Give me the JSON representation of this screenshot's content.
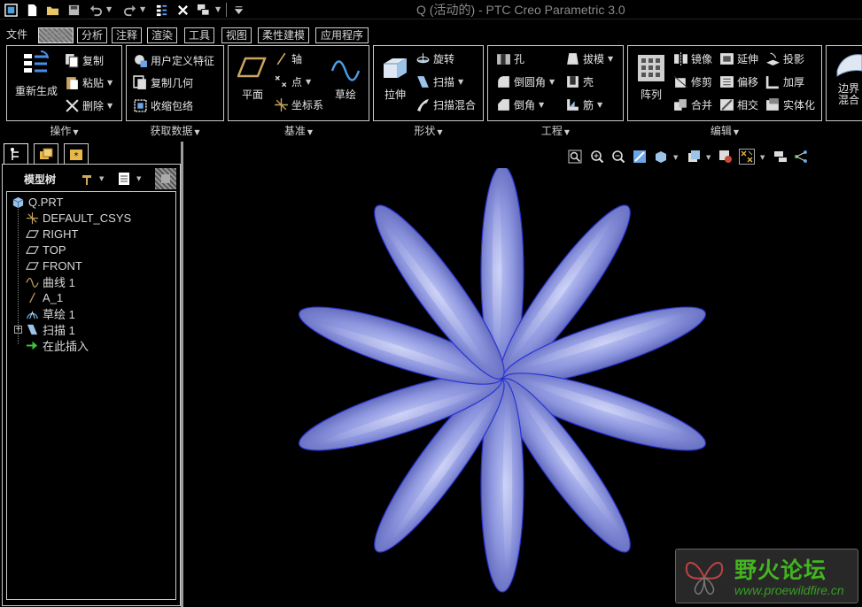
{
  "window": {
    "title": "Q (活动的) - PTC Creo Parametric 3.0"
  },
  "quick_access": {
    "icons": [
      "app-icon",
      "new-file-icon",
      "open-icon",
      "save-icon",
      "undo-icon",
      "redo-icon",
      "regenerate-icon",
      "close-window-icon",
      "switch-windows-icon",
      "customize-icon"
    ]
  },
  "tabs": [
    {
      "label": "文件"
    },
    {
      "label": "模型"
    },
    {
      "label": "分析"
    },
    {
      "label": "注释"
    },
    {
      "label": "渲染"
    },
    {
      "label": "工具"
    },
    {
      "label": "视图"
    },
    {
      "label": "柔性建模"
    },
    {
      "label": "应用程序"
    }
  ],
  "ribbon": {
    "operations": {
      "label": "操作",
      "regenerate": "重新生成",
      "copy": "复制",
      "paste": "粘贴",
      "delete": "删除"
    },
    "get_data": {
      "label": "获取数据",
      "udf": "用户定义特征",
      "copy_geometry": "复制几何",
      "shrinkwrap": "收缩包络"
    },
    "datum": {
      "label": "基准",
      "plane": "平面",
      "axis": "轴",
      "point": "点",
      "csys": "坐标系",
      "sketch": "草绘"
    },
    "shapes": {
      "label": "形状",
      "extrude": "拉伸",
      "revolve": "旋转",
      "sweep": "扫描",
      "swept_blend": "扫描混合"
    },
    "engineering": {
      "label": "工程",
      "hole": "孔",
      "round": "倒圆角",
      "chamfer": "倒角",
      "draft": "拔模",
      "shell": "壳",
      "rib": "筋"
    },
    "editing": {
      "label": "编辑",
      "pattern": "阵列",
      "mirror": "镜像",
      "extend": "延伸",
      "project": "投影",
      "trim": "修剪",
      "offset": "偏移",
      "thicken": "加厚",
      "merge": "合并",
      "intersect": "相交",
      "solidify": "实体化"
    },
    "surfaces": {
      "boundary_blend_1": "边界",
      "boundary_blend_2": "混合"
    }
  },
  "model_tree": {
    "title": "模型树",
    "items": [
      {
        "label": "Q.PRT",
        "icon": "part-icon"
      },
      {
        "label": "DEFAULT_CSYS",
        "icon": "csys-icon"
      },
      {
        "label": "RIGHT",
        "icon": "datum-plane-icon"
      },
      {
        "label": "TOP",
        "icon": "datum-plane-icon"
      },
      {
        "label": "FRONT",
        "icon": "datum-plane-icon"
      },
      {
        "label": "曲线 1",
        "icon": "curve-icon"
      },
      {
        "label": "A_1",
        "icon": "axis-icon"
      },
      {
        "label": "草绘 1",
        "icon": "sketch-icon"
      },
      {
        "label": "扫描 1",
        "icon": "sweep-icon"
      },
      {
        "label": "在此插入",
        "icon": "insert-here-icon"
      }
    ]
  },
  "view_toolbar": {
    "icons": [
      "refit-icon",
      "zoom-in-icon",
      "zoom-out-icon",
      "repaint-icon",
      "display-style-icon",
      "saved-views-icon",
      "view-manager-icon",
      "datum-display-icon",
      "annotation-display-icon",
      "spin-center-icon"
    ]
  },
  "model": {
    "petal_count": 10,
    "petal_color": "#8f98df",
    "edge_color": "#2b34d6"
  },
  "watermark": {
    "name": "野火论坛",
    "url": "www.proewildfire.cn"
  },
  "colors": {
    "background": "#000000",
    "ui_text": "#d8d8d8",
    "watermark_green": "#42b51f"
  }
}
